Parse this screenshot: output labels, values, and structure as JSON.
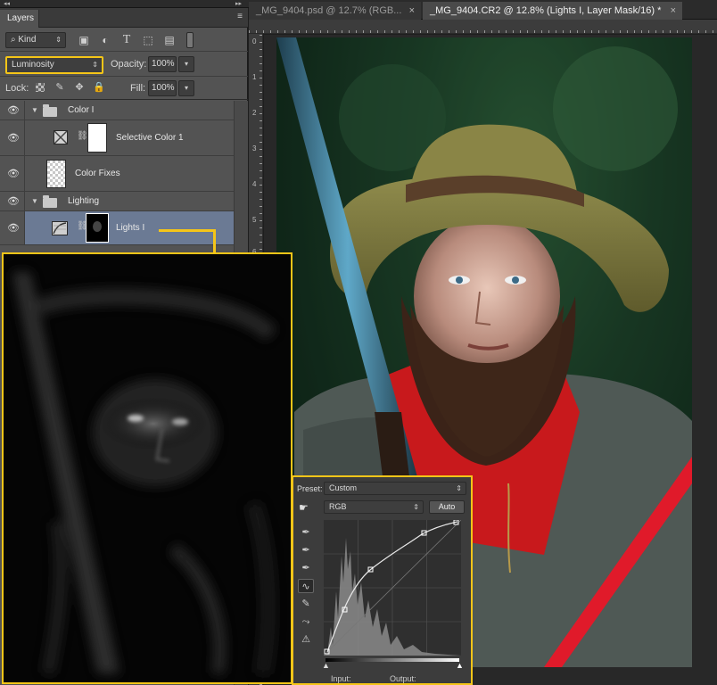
{
  "panel": {
    "title": "Layers",
    "menu_glyph": "≡",
    "kind_label": "Kind",
    "blend_mode": "Luminosity",
    "opacity_label": "Opacity:",
    "opacity_value": "100%",
    "lock_label": "Lock:",
    "fill_label": "Fill:",
    "fill_value": "100%"
  },
  "layers": {
    "group_color": "Color I",
    "selective_color": "Selective Color 1",
    "color_fixes": "Color Fixes",
    "group_lighting": "Lighting",
    "lights": "Lights I"
  },
  "tabs": {
    "inactive_label": "_MG_9404.psd @ 12.7% (RGB...",
    "active_label": "_MG_9404.CR2 @ 12.8% (Lights I, Layer Mask/16) *",
    "close_glyph": "×"
  },
  "ruler": {
    "marks": [
      "0",
      "1",
      "2",
      "3",
      "4",
      "5",
      "6"
    ]
  },
  "curves": {
    "preset_label": "Preset:",
    "preset_value": "Custom",
    "channel_value": "RGB",
    "auto_label": "Auto",
    "input_label": "Input:",
    "output_label": "Output:"
  },
  "icons": {
    "eye": "👁",
    "collapse": "◂◂"
  },
  "colors": {
    "highlight": "#f5c518",
    "selected_row": "#6b7a94",
    "panel_bg": "#535353"
  }
}
